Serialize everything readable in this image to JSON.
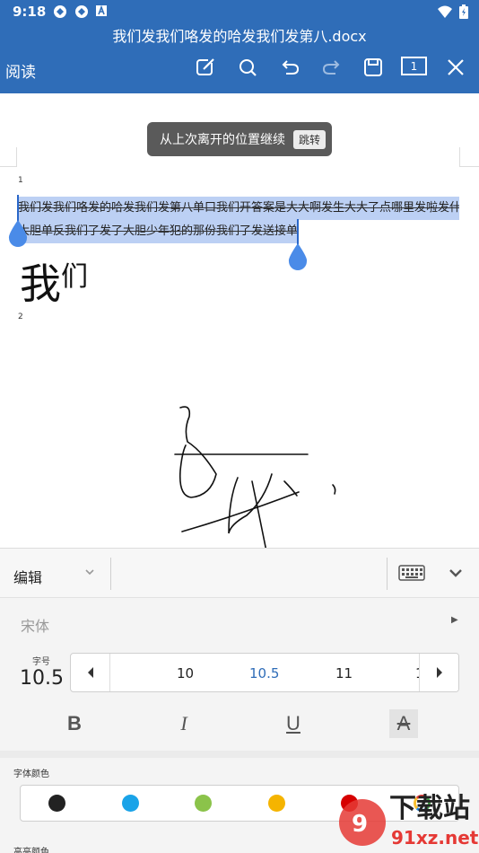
{
  "status_bar": {
    "time": "9:18",
    "app_icon_label": "A"
  },
  "title_bar": {
    "document_title": "我们发我们咯发的哈发我们发第八.docx",
    "read_label": "阅读",
    "page_indicator": "1",
    "icons": [
      "edit-icon",
      "search-icon",
      "undo-icon",
      "redo-icon",
      "save-icon",
      "page-icon",
      "close-icon"
    ]
  },
  "toast": {
    "message": "从上次离开的位置继续",
    "action": "跳转"
  },
  "document": {
    "page1_number": "1",
    "page2_number": "2",
    "selected_line_1": "我们发我们咯发的哈发我们发第八单口我们开答案是大大啊发生大大了点哪里发啦发什么",
    "selected_line_2": "大胆单反我们了发了大胆少年犯的那份我们了发送接单发",
    "big_text_1": "我",
    "big_text_2": "们",
    "selection_color": "#bcd0f4",
    "handle_color": "#4a8be8"
  },
  "edit_panel": {
    "mode_label": "编辑",
    "font_name": "宋体",
    "size_caption": "字号",
    "current_size": "10.5",
    "size_options": [
      "10",
      "10.5",
      "11",
      "1"
    ],
    "format_buttons": {
      "bold": "B",
      "italic": "I",
      "underline": "U",
      "strikethrough": "A"
    },
    "font_color_caption": "字体颜色",
    "font_colors": [
      "#222222",
      "#1aa3e8",
      "#8bc34a",
      "#f5b400",
      "#d60000"
    ],
    "highlight_caption": "高亮颜色"
  },
  "watermark": {
    "text": "下载站",
    "url_text": "91xz.net"
  },
  "colors": {
    "accent": "#2f6db8",
    "panel_bg": "#f4f4f4"
  }
}
